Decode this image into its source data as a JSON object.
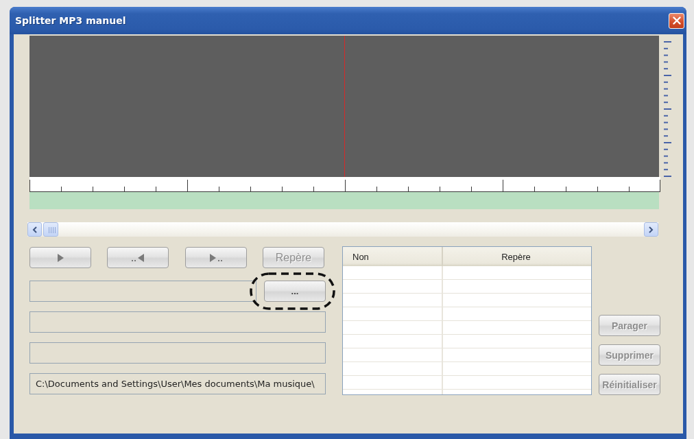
{
  "window": {
    "title": "Splitter MP3 manuel"
  },
  "transport_buttons": [
    {
      "kind": "play",
      "disabled": false
    },
    {
      "kind": "previous_marker",
      "disabled": false
    },
    {
      "kind": "next_marker",
      "disabled": false
    },
    {
      "kind": "text",
      "label": "Repère",
      "disabled": true
    }
  ],
  "fields": [
    {
      "kind": "file",
      "browse_button": {
        "label": "...",
        "highlighted": true
      }
    },
    {
      "kind": "text"
    },
    {
      "kind": "text"
    },
    {
      "kind": "text",
      "value": "C:\\Documents and Settings\\User\\Mes documents\\Ma musique\\"
    }
  ],
  "marker_table": {
    "columns": [
      "Non",
      "Repère"
    ]
  },
  "actions": [
    {
      "label": "Parager",
      "disabled": true
    },
    {
      "label": "Supprimer",
      "disabled": true
    },
    {
      "label": "Réinitialiser",
      "disabled": true
    }
  ]
}
